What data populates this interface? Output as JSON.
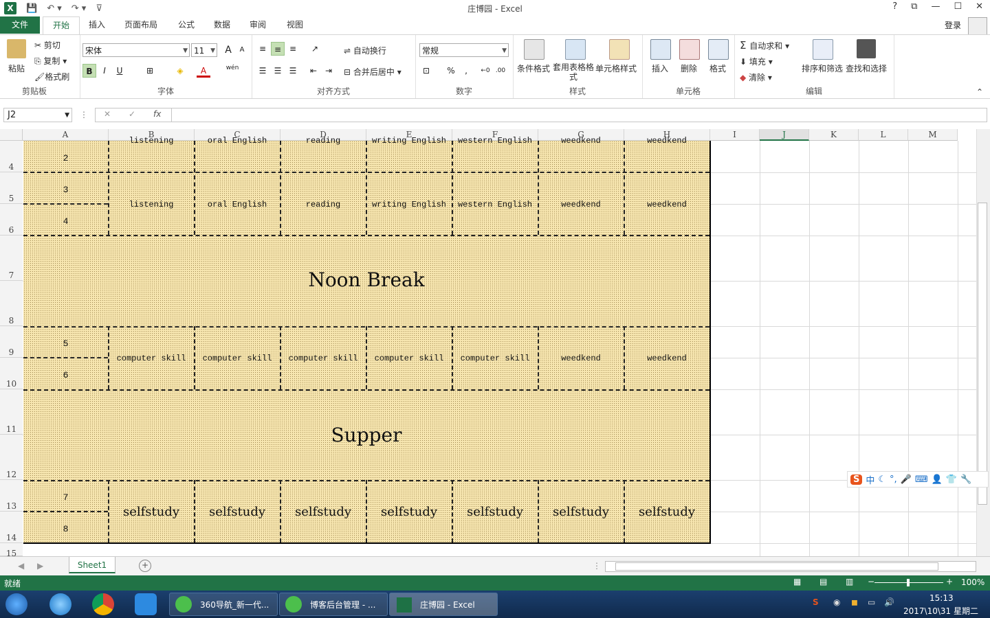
{
  "titlebar": {
    "title": "庄博园 - Excel",
    "help": "?",
    "restore": "⧉",
    "minimize": "—",
    "maximize": "☐",
    "close": "✕"
  },
  "tabs": {
    "file": "文件",
    "items": [
      "开始",
      "插入",
      "页面布局",
      "公式",
      "数据",
      "审阅",
      "视图"
    ],
    "login": "登录"
  },
  "ribbon": {
    "clipboard": {
      "paste": "粘贴",
      "cut": "剪切",
      "copy": "复制",
      "format_painter": "格式刷",
      "label": "剪贴板"
    },
    "font": {
      "name": "宋体",
      "size": "11",
      "bold": "B",
      "italic": "I",
      "underline": "U",
      "label": "字体",
      "grow": "A",
      "shrink": "A",
      "color": "A",
      "wen": "wén"
    },
    "alignment": {
      "wrap": "自动换行",
      "merge": "合并后居中",
      "label": "对齐方式"
    },
    "number": {
      "format": "常规",
      "percent": "%",
      "comma": ",",
      "label": "数字"
    },
    "styles": {
      "conditional": "条件格式",
      "table": "套用表格格式",
      "cell": "单元格样式",
      "label": "样式"
    },
    "cells": {
      "insert": "插入",
      "delete": "删除",
      "format": "格式",
      "label": "单元格"
    },
    "editing": {
      "autosum": "自动求和",
      "fill": "填充",
      "clear": "清除",
      "sort": "排序和筛选",
      "find": "查找和选择",
      "label": "编辑"
    }
  },
  "formula": {
    "name_box": "J2",
    "fx": "fx",
    "cancel": "✕",
    "enter": "✓",
    "value": ""
  },
  "columns": [
    "A",
    "B",
    "C",
    "D",
    "E",
    "F",
    "G",
    "H",
    "I",
    "J",
    "K",
    "L",
    "M"
  ],
  "selected_column": "J",
  "rows": [
    "4",
    "5",
    "6",
    "7",
    "8",
    "9",
    "10",
    "11",
    "12",
    "13",
    "14",
    "15"
  ],
  "schedule": {
    "top_partial": [
      "listening",
      "oral English",
      "reading",
      "writing English",
      "western English",
      "weedkend",
      "weedkend"
    ],
    "period_a": [
      "2",
      "3",
      "4"
    ],
    "block1": [
      "listening",
      "oral English",
      "reading",
      "writing English",
      "western English",
      "weedkend",
      "weedkend"
    ],
    "noon": "Noon Break",
    "period_b": [
      "5",
      "6"
    ],
    "block2": [
      "computer skill",
      "computer skill",
      "computer skill",
      "computer skill",
      "computer skill",
      "weedkend",
      "weedkend"
    ],
    "supper": "Supper",
    "period_c": [
      "7",
      "8"
    ],
    "block3": [
      "selfstudy",
      "selfstudy",
      "selfstudy",
      "selfstudy",
      "selfstudy",
      "selfstudy",
      "selfstudy"
    ]
  },
  "sheet": {
    "name": "Sheet1",
    "add": "+"
  },
  "status": {
    "ready": "就绪",
    "zoom": "100%"
  },
  "taskbar": {
    "apps": [
      "360导航_新一代...",
      "博客后台管理 - ...",
      "庄博园 - Excel"
    ],
    "time": "15:13",
    "date": "2017\\10\\31 星期二"
  },
  "ime": {
    "label": "中"
  },
  "colors": {
    "excel_green": "#217346",
    "cell_fill": "#f7e6b0"
  }
}
